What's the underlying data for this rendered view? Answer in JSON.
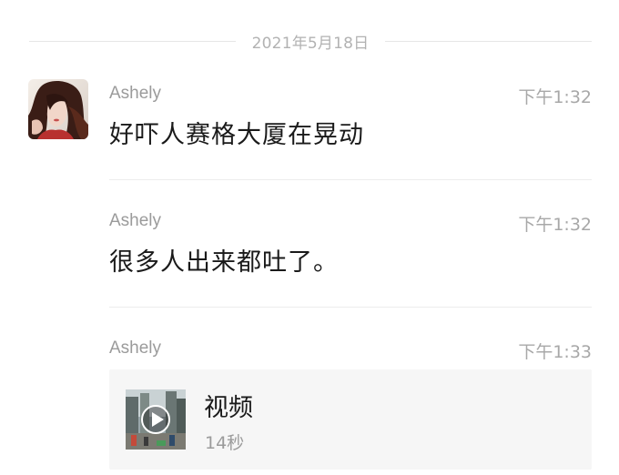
{
  "date_separator": "2021年5月18日",
  "messages": [
    {
      "sender": "Ashely",
      "time": "下午1:32",
      "text": "好吓人赛格大厦在晃动"
    },
    {
      "sender": "Ashely",
      "time": "下午1:32",
      "text": "很多人出来都吐了。"
    },
    {
      "sender": "Ashely",
      "time": "下午1:33",
      "video": {
        "title": "视频",
        "duration": "14秒"
      }
    }
  ]
}
